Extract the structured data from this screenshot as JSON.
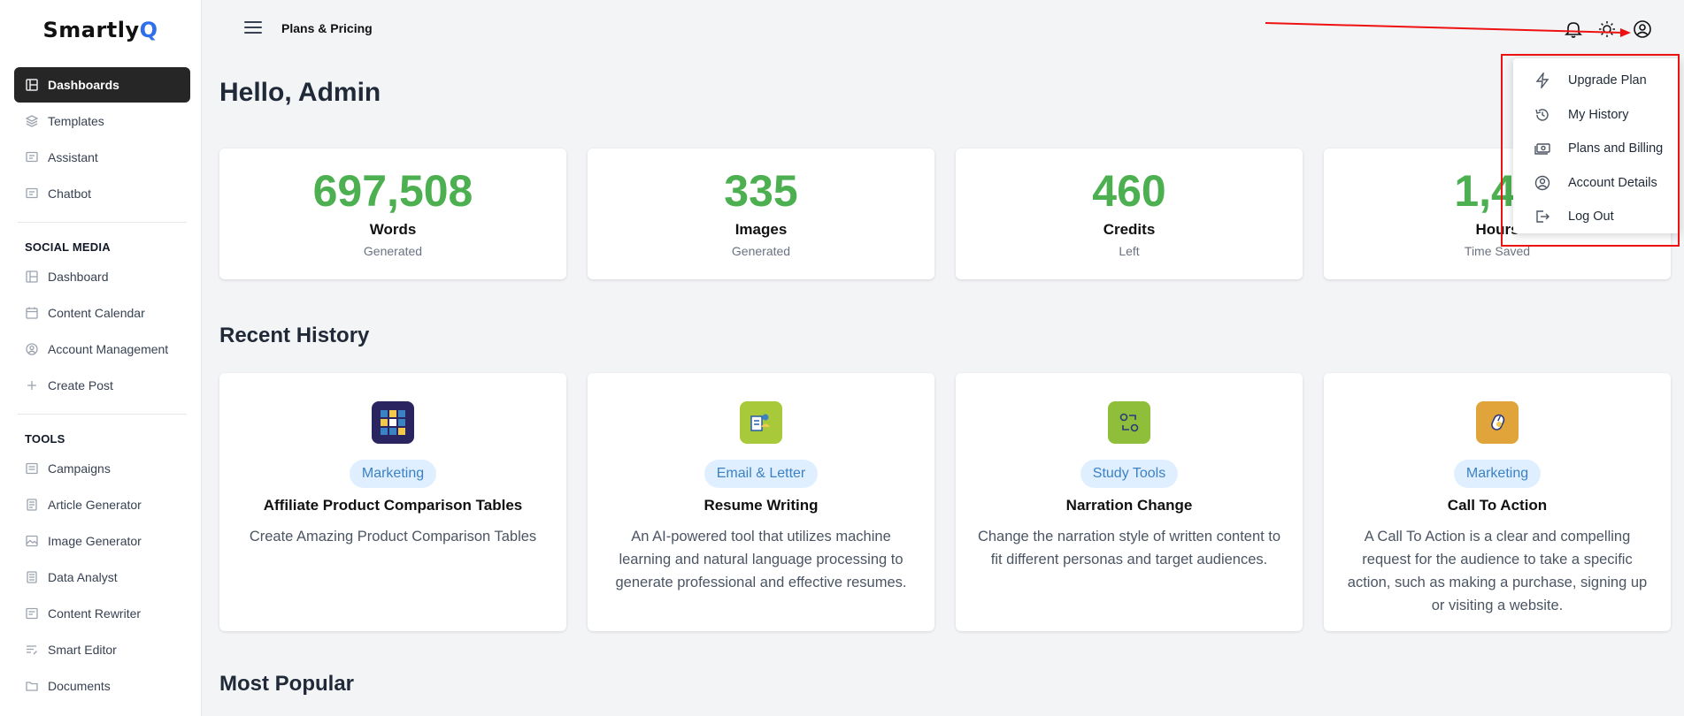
{
  "logo": {
    "text": "Smartly",
    "accent": "Q"
  },
  "sidebar": {
    "main_items": [
      {
        "label": "Dashboards",
        "icon": "layout-icon",
        "active": true
      },
      {
        "label": "Templates",
        "icon": "layers-icon"
      },
      {
        "label": "Assistant",
        "icon": "message-icon"
      },
      {
        "label": "Chatbot",
        "icon": "message-icon"
      }
    ],
    "social_heading": "SOCIAL MEDIA",
    "social_items": [
      {
        "label": "Dashboard",
        "icon": "layout-icon"
      },
      {
        "label": "Content Calendar",
        "icon": "calendar-icon"
      },
      {
        "label": "Account Management",
        "icon": "user-circle-icon"
      },
      {
        "label": "Create Post",
        "icon": "plus-icon"
      }
    ],
    "tools_heading": "TOOLS",
    "tools_items": [
      {
        "label": "Campaigns",
        "icon": "campaign-icon"
      },
      {
        "label": "Article Generator",
        "icon": "article-icon"
      },
      {
        "label": "Image Generator",
        "icon": "image-icon"
      },
      {
        "label": "Data Analyst",
        "icon": "data-icon"
      },
      {
        "label": "Content Rewriter",
        "icon": "rewrite-icon"
      },
      {
        "label": "Smart Editor",
        "icon": "editor-icon"
      },
      {
        "label": "Documents",
        "icon": "folder-icon"
      }
    ]
  },
  "header": {
    "breadcrumb": "Plans & Pricing"
  },
  "main": {
    "greeting": "Hello, Admin",
    "stats": [
      {
        "value": "697,508",
        "label": "Words",
        "sub": "Generated"
      },
      {
        "value": "335",
        "label": "Images",
        "sub": "Generated"
      },
      {
        "value": "460",
        "label": "Credits",
        "sub": "Left"
      },
      {
        "value": "1,40",
        "label": "Hours",
        "sub": "Time Saved"
      }
    ],
    "recent_title": "Recent History",
    "recent": [
      {
        "badge": "Marketing",
        "title": "Affiliate Product Comparison Tables",
        "desc": "Create Amazing Product Comparison Tables",
        "icon_bg": "#2a2560",
        "icon": "comparison-grid-icon"
      },
      {
        "badge": "Email & Letter",
        "title": "Resume Writing",
        "desc": "An AI-powered tool that utilizes machine learning and natural language processing to generate professional and effective resumes.",
        "icon_bg": "#a8c93a",
        "icon": "resume-icon"
      },
      {
        "badge": "Study Tools",
        "title": "Narration Change",
        "desc": "Change the narration style of written content to fit different personas and target audiences.",
        "icon_bg": "#8fbf3a",
        "icon": "narration-icon"
      },
      {
        "badge": "Marketing",
        "title": "Call To Action",
        "desc": "A Call To Action is a clear and compelling request for the audience to take a specific action, such as making a purchase, signing up or visiting a website.",
        "icon_bg": "#e0a43a",
        "icon": "click-icon"
      }
    ],
    "popular_title": "Most Popular"
  },
  "dropdown": {
    "items": [
      {
        "label": "Upgrade Plan",
        "icon": "bolt-icon"
      },
      {
        "label": "My History",
        "icon": "history-icon"
      },
      {
        "label": "Plans and Billing",
        "icon": "billing-icon"
      },
      {
        "label": "Account Details",
        "icon": "user-circle-icon"
      },
      {
        "label": "Log Out",
        "icon": "logout-icon"
      }
    ]
  },
  "colors": {
    "accent_green": "#4caf50",
    "active_nav": "#262626",
    "badge_bg": "#e0efff",
    "badge_text": "#3b82c4",
    "annotation_red": "#e11"
  }
}
